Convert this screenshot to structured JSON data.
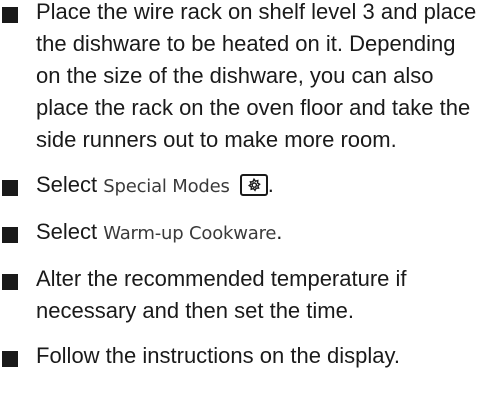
{
  "instructions": [
    {
      "text": "Place the wire rack on shelf level 3 and place the dishware to be heated on it. Depending on the size of the dishware, you can also place the rack on the oven floor and take the side runners out to make more room."
    },
    {
      "prefix": "Select ",
      "term": "Special Modes",
      "icon": "special-modes-icon",
      "suffix": "."
    },
    {
      "prefix": "Select ",
      "term": "Warm-up Cookware",
      "suffix": "."
    },
    {
      "text": "Alter the recommended temperature if necessary and then set the time."
    },
    {
      "text": "Follow the instructions on the display."
    }
  ],
  "colors": {
    "text": "#1a1a1a",
    "ui_term": "#3a3a3a",
    "background": "#ffffff"
  }
}
